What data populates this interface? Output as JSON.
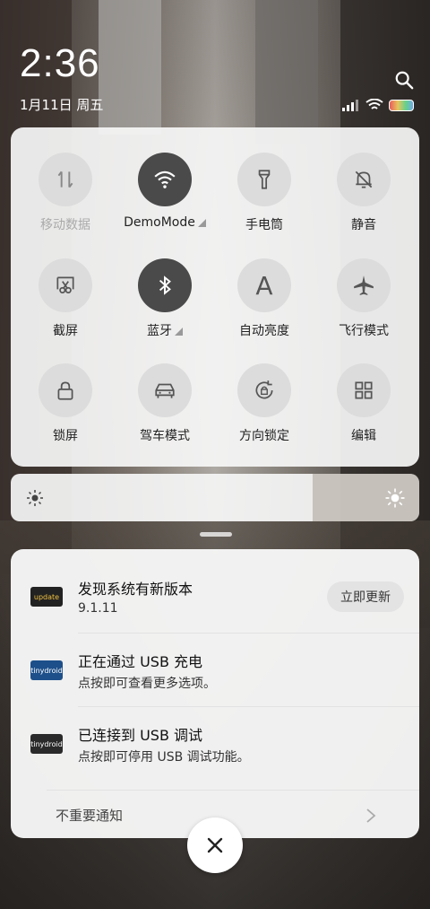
{
  "status_bar": {
    "time": "2:36",
    "date": "1月11日 周五",
    "icons": [
      "signal-icon",
      "wifi-icon",
      "battery-icon"
    ]
  },
  "quick_settings": {
    "tiles": [
      {
        "label": "移动数据",
        "icon": "mobile-data-icon",
        "state": "off"
      },
      {
        "label": "DemoMode",
        "icon": "wifi-icon",
        "state": "on"
      },
      {
        "label": "手电筒",
        "icon": "flashlight-icon",
        "state": "off"
      },
      {
        "label": "静音",
        "icon": "mute-bell-icon",
        "state": "off"
      },
      {
        "label": "截屏",
        "icon": "screenshot-icon",
        "state": "off"
      },
      {
        "label": "蓝牙",
        "icon": "bluetooth-icon",
        "state": "on"
      },
      {
        "label": "自动亮度",
        "icon": "auto-brightness-icon",
        "state": "off"
      },
      {
        "label": "飞行模式",
        "icon": "airplane-icon",
        "state": "off"
      },
      {
        "label": "锁屏",
        "icon": "lock-icon",
        "state": "off"
      },
      {
        "label": "驾车模式",
        "icon": "car-icon",
        "state": "off"
      },
      {
        "label": "方向锁定",
        "icon": "rotation-lock-icon",
        "state": "off"
      },
      {
        "label": "编辑",
        "icon": "edit-grid-icon",
        "state": "off"
      }
    ],
    "auto_brightness_glyph": "A"
  },
  "brightness": {
    "level": 0.74
  },
  "notifications": {
    "items": [
      {
        "app_badge": "update",
        "title": "发现系统有新版本",
        "text": "9.1.11",
        "action": "立即更新"
      },
      {
        "app_badge": "tinydroid",
        "title": "正在通过 USB 充电",
        "text": "点按即可查看更多选项。"
      },
      {
        "app_badge": "tinydroid",
        "title": "已连接到 USB 调试",
        "text": "点按即可停用 USB 调试功能。"
      }
    ],
    "unimportant_label": "不重要通知"
  },
  "colors": {
    "tile_on": "#4a4a4a",
    "tile_off": "#dcdcdc"
  }
}
